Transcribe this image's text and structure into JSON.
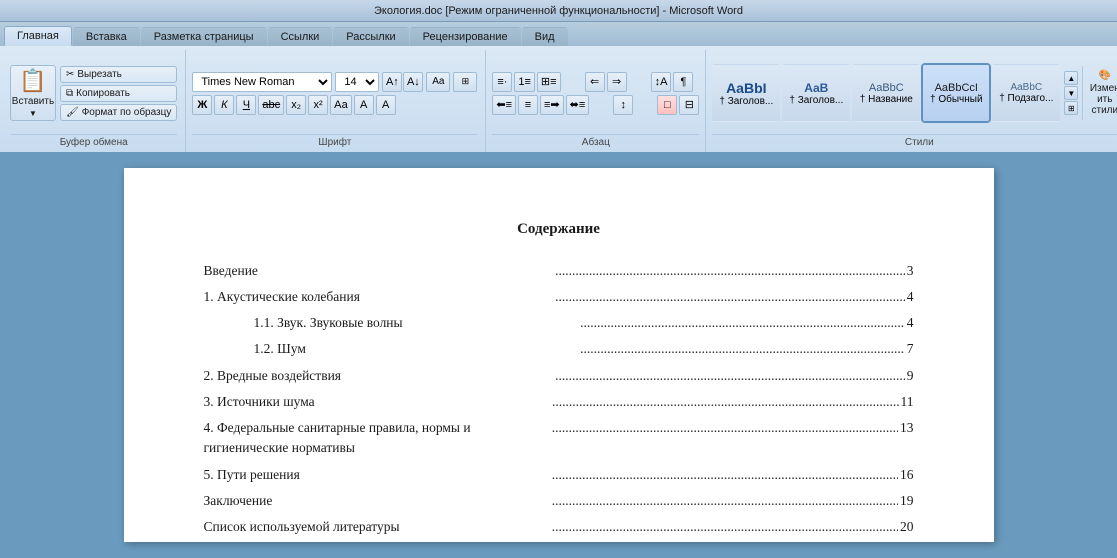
{
  "titleBar": {
    "text": "Экология.doc [Режим ограниченной функциональности] - Microsoft Word"
  },
  "ribbon": {
    "tabs": [
      "Главная",
      "Вставка",
      "Разметка страницы",
      "Ссылки",
      "Рассылки",
      "Рецензирование",
      "Вид"
    ],
    "activeTab": "Главная",
    "groups": {
      "clipboard": {
        "label": "Буфер обмена",
        "paste": "Вставить",
        "cut": "Вырезать",
        "copy": "Копировать",
        "formatPainter": "Формат по образцу"
      },
      "font": {
        "label": "Шрифт",
        "fontName": "Times New Roman",
        "fontSize": "14",
        "bold": "Ж",
        "italic": "К",
        "underline": "Ч",
        "strikethrough": "аbc",
        "subscript": "x₂",
        "superscript": "x²",
        "changeCase": "Аа",
        "textColor": "А",
        "highlight": "А"
      },
      "paragraph": {
        "label": "Абзац",
        "bullets": "≡",
        "numbering": "≡",
        "multilevel": "≡",
        "decreaseIndent": "←",
        "increaseIndent": "→",
        "sort": "↕",
        "showHide": "¶",
        "alignLeft": "⟵",
        "alignCenter": "≡",
        "alignRight": "⟶",
        "justify": "≡",
        "lineSpacing": "↕",
        "shading": "□",
        "borders": "□"
      },
      "styles": {
        "label": "Стили",
        "items": [
          {
            "name": "Заголов...",
            "preview": "AaBbI",
            "type": "heading1"
          },
          {
            "name": "† Заголов...",
            "preview": "AaB",
            "type": "heading2"
          },
          {
            "name": "† Название",
            "preview": "AaBbC",
            "type": "title"
          },
          {
            "name": "† Обычный",
            "preview": "AaBbCcI",
            "type": "normal",
            "active": true
          },
          {
            "name": "† Подзаго...",
            "preview": "AaBbC",
            "type": "subtitle"
          }
        ],
        "editStylesLabel": "Изменить стили"
      }
    }
  },
  "document": {
    "tocTitle": "Содержание",
    "entries": [
      {
        "text": "Введение",
        "dots": true,
        "page": "3",
        "indent": 0
      },
      {
        "text": "1. Акустические колебания",
        "dots": true,
        "page": "4",
        "indent": 0
      },
      {
        "text": "1.1. Звук. Звуковые волны",
        "dots": true,
        "page": "4",
        "indent": 1
      },
      {
        "text": "1.2. Шум",
        "dots": true,
        "page": "7",
        "indent": 1
      },
      {
        "text": "2. Вредные воздействия",
        "dots": true,
        "page": "9",
        "indent": 0
      },
      {
        "text": "3. Источники шума",
        "dots": true,
        "page": "11",
        "indent": 0
      },
      {
        "text": "4. Федеральные санитарные правила, нормы и гигиенические нормативы",
        "dots": true,
        "page": "13",
        "indent": 0
      },
      {
        "text": "5. Пути решения",
        "dots": true,
        "page": "16",
        "indent": 0
      },
      {
        "text": "Заключение",
        "dots": true,
        "page": "19",
        "indent": 0
      },
      {
        "text": "Список используемой литературы",
        "dots": true,
        "page": "20",
        "indent": 0
      }
    ]
  }
}
